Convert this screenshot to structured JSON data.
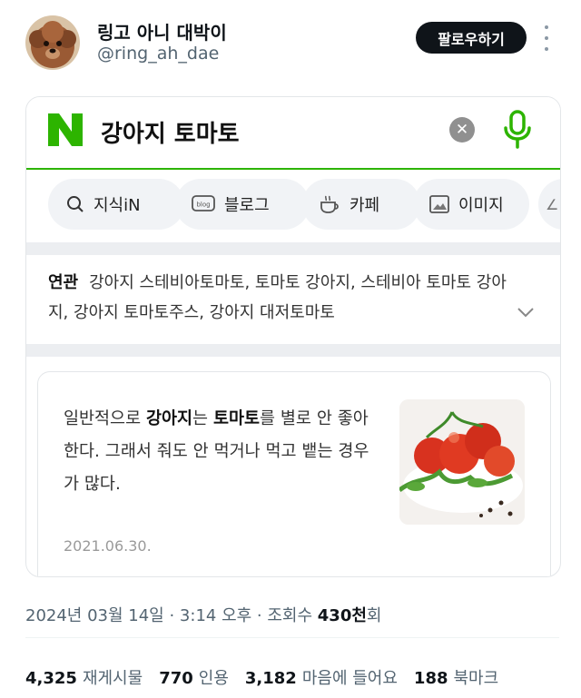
{
  "tweet": {
    "author": {
      "display_name": "링고 아니 대박이",
      "handle": "@ring_ah_dae",
      "avatar_icon": "dog-avatar-icon"
    },
    "follow_label": "팔로우하기",
    "more_icon": "more-vertical-icon"
  },
  "screenshot": {
    "search": {
      "query": "강아지 토마토",
      "logo_icon": "naver-logo-icon",
      "clear_icon": "clear-x-icon",
      "mic_icon": "microphone-icon",
      "accent": "#2db400"
    },
    "chips": [
      {
        "label": "지식iN",
        "icon": "search-icon"
      },
      {
        "label": "블로그",
        "icon": "blog-icon"
      },
      {
        "label": "카페",
        "icon": "cafe-cup-icon"
      },
      {
        "label": "이미지",
        "icon": "image-icon"
      }
    ],
    "related": {
      "label": "연관",
      "text": "강아지 스테비아토마토, 토마토 강아지, 스테비아 토마토 강아지, 강아지 토마토주스, 강아지 대저토마토"
    },
    "result": {
      "parts": {
        "a": "일반적으로 ",
        "b": "강아지",
        "c": "는 ",
        "d": "토마토",
        "e": "를 별로 안 좋아한다. 그래서 줘도 안 먹거나 먹고 뱉는 경우가 많다."
      },
      "date": "2021.06.30.",
      "thumbnail_icon": "tomato-photo"
    }
  },
  "meta": {
    "date": "2024년 03월 14일",
    "time": "3:14 오후",
    "views_prefix": "조회수",
    "views_value": "430천",
    "views_suffix": "회"
  },
  "stats": {
    "retweets": {
      "count": "4,325",
      "label": "재게시물"
    },
    "quotes": {
      "count": "770",
      "label": "인용"
    },
    "likes": {
      "count": "3,182",
      "label": "마음에 들어요"
    },
    "bookmarks": {
      "count": "188",
      "label": "북마크"
    }
  }
}
